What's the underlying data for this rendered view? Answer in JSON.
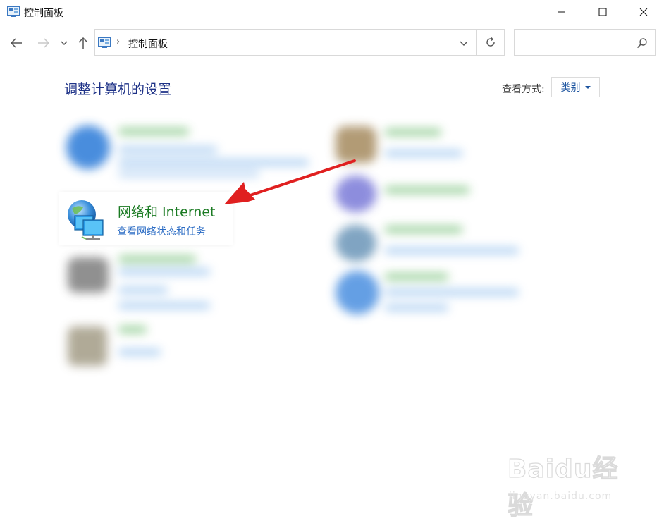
{
  "window": {
    "title": "控制面板"
  },
  "address_bar": {
    "path": "控制面板",
    "separator": "›"
  },
  "search": {
    "placeholder": ""
  },
  "header": {
    "heading": "调整计算机的设置",
    "view_by_label": "查看方式:",
    "view_by_value": "类别"
  },
  "highlighted_category": {
    "title": "网络和 Internet",
    "link": "查看网络状态和任务"
  },
  "watermark": {
    "brand": "Baidu经验",
    "url": "jingyan.baidu.com"
  },
  "colors": {
    "heading": "#1e3287",
    "category_title": "#1a7a22",
    "link": "#2a6bc4",
    "arrow": "#e02020"
  },
  "icons": [
    "control-panel-icon",
    "back-arrow-icon",
    "forward-arrow-icon",
    "chevron-down-icon",
    "up-arrow-icon",
    "refresh-icon",
    "search-icon",
    "minimize-icon",
    "maximize-icon",
    "close-icon",
    "network-internet-icon"
  ]
}
